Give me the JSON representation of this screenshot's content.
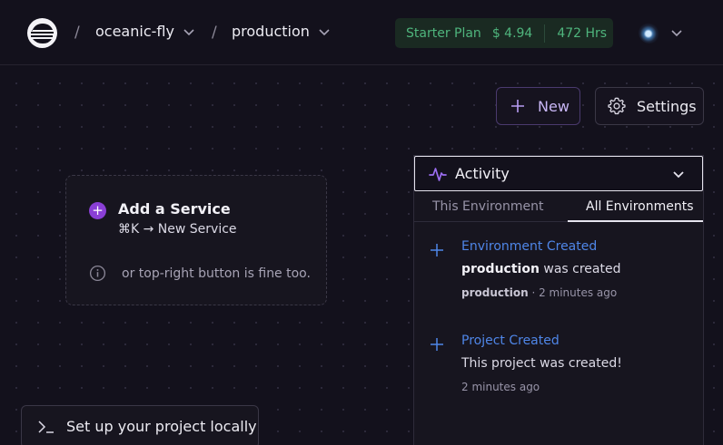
{
  "header": {
    "breadcrumbs": [
      {
        "label": "oceanic-fly"
      },
      {
        "label": "production"
      }
    ],
    "separator": "/",
    "plan": {
      "name": "Starter Plan",
      "cost": "$ 4.94",
      "hours": "472 Hrs"
    }
  },
  "toolbar": {
    "new_label": "New",
    "settings_label": "Settings"
  },
  "service_card": {
    "title": "Add a Service",
    "shortcut": "⌘K → New Service",
    "hint": "or top-right button is fine too."
  },
  "activity": {
    "title": "Activity",
    "tabs": [
      {
        "label": "This Environment",
        "active": false
      },
      {
        "label": "All Environments",
        "active": true
      }
    ],
    "events": [
      {
        "title": "Environment Created",
        "desc_bold": "production",
        "desc_rest": " was created",
        "meta_bold": "production",
        "meta_rest": " · 2 minutes ago"
      },
      {
        "title": "Project Created",
        "desc_bold": "",
        "desc_rest": "This project was created!",
        "meta_bold": "",
        "meta_rest": "2 minutes ago"
      }
    ]
  },
  "local_setup": {
    "label": "Set up your project locally"
  },
  "colors": {
    "background": "#13111c",
    "accent_purple": "#8a3fd6",
    "link_blue": "#4f86e8",
    "plan_green": "#4fb57d"
  },
  "icons": [
    "logo-icon",
    "chevron-down-icon",
    "plus-icon",
    "gear-icon",
    "info-icon",
    "activity-pulse-icon",
    "terminal-icon"
  ]
}
